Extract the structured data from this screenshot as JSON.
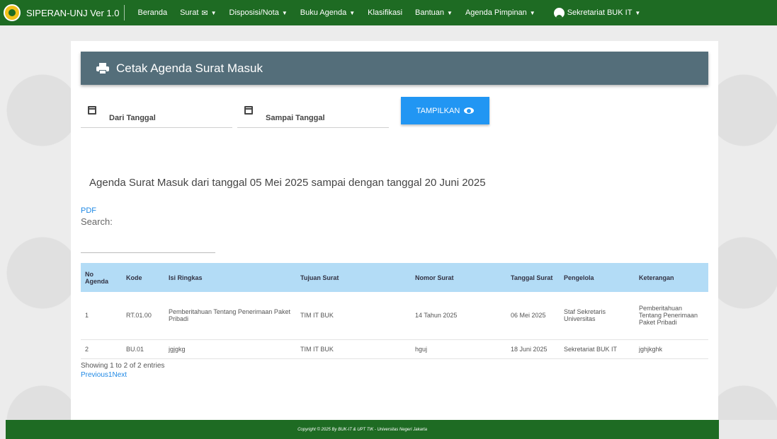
{
  "navbar": {
    "brand": "SIPERAN-UNJ Ver 1.0",
    "items": [
      {
        "label": "Beranda",
        "dropdown": false
      },
      {
        "label": "Surat",
        "dropdown": true,
        "icon": "envelope-icon"
      },
      {
        "label": "Disposisi/Nota",
        "dropdown": true
      },
      {
        "label": "Buku Agenda",
        "dropdown": true
      },
      {
        "label": "Klasifikasi",
        "dropdown": false
      },
      {
        "label": "Bantuan",
        "dropdown": true
      },
      {
        "label": "Agenda Pimpinan",
        "dropdown": true
      }
    ],
    "user": "Sekretariat BUK IT"
  },
  "header": {
    "title": "Cetak Agenda Surat Masuk"
  },
  "filters": {
    "from_label": "Dari Tanggal",
    "to_label": "Sampai Tanggal",
    "button_label": "TAMPILKAN"
  },
  "report": {
    "title": "Agenda Surat Masuk dari tanggal 05 Mei 2025 sampai dengan tanggal 20 Juni 2025",
    "pdf_label": "PDF",
    "search_label": "Search:"
  },
  "table": {
    "columns": [
      "No Agenda",
      "Kode",
      "Isi Ringkas",
      "Tujuan Surat",
      "Nomor Surat",
      "Tanggal Surat",
      "Pengelola",
      "Keterangan"
    ],
    "rows": [
      [
        "1",
        "RT.01.00",
        "Pemberitahuan Tentang Penerimaan Paket Pribadi",
        "TIM IT BUK",
        "14 Tahun 2025",
        "06 Mei 2025",
        "Staf Sekretaris Universitas",
        "Pemberitahuan Tentang Penerimaan Paket Pribadi"
      ],
      [
        "2",
        "BU.01",
        "jgjgkg",
        "TIM IT BUK",
        "hguj",
        "18 Juni 2025",
        "Sekretariat BUK IT",
        "jghjkghk"
      ]
    ],
    "info": "Showing 1 to 2 of 2 entries",
    "pager": {
      "previous": "Previous",
      "page": "1",
      "next": "Next"
    }
  },
  "footer": {
    "text": "Copyright © 2025 By BUK-IT & UPT TIK - Universitas Negeri Jakarta"
  },
  "colors": {
    "navbar": "#1e6b23",
    "header": "#546e7a",
    "button": "#2196f3",
    "table_header": "#b3dcf6"
  }
}
